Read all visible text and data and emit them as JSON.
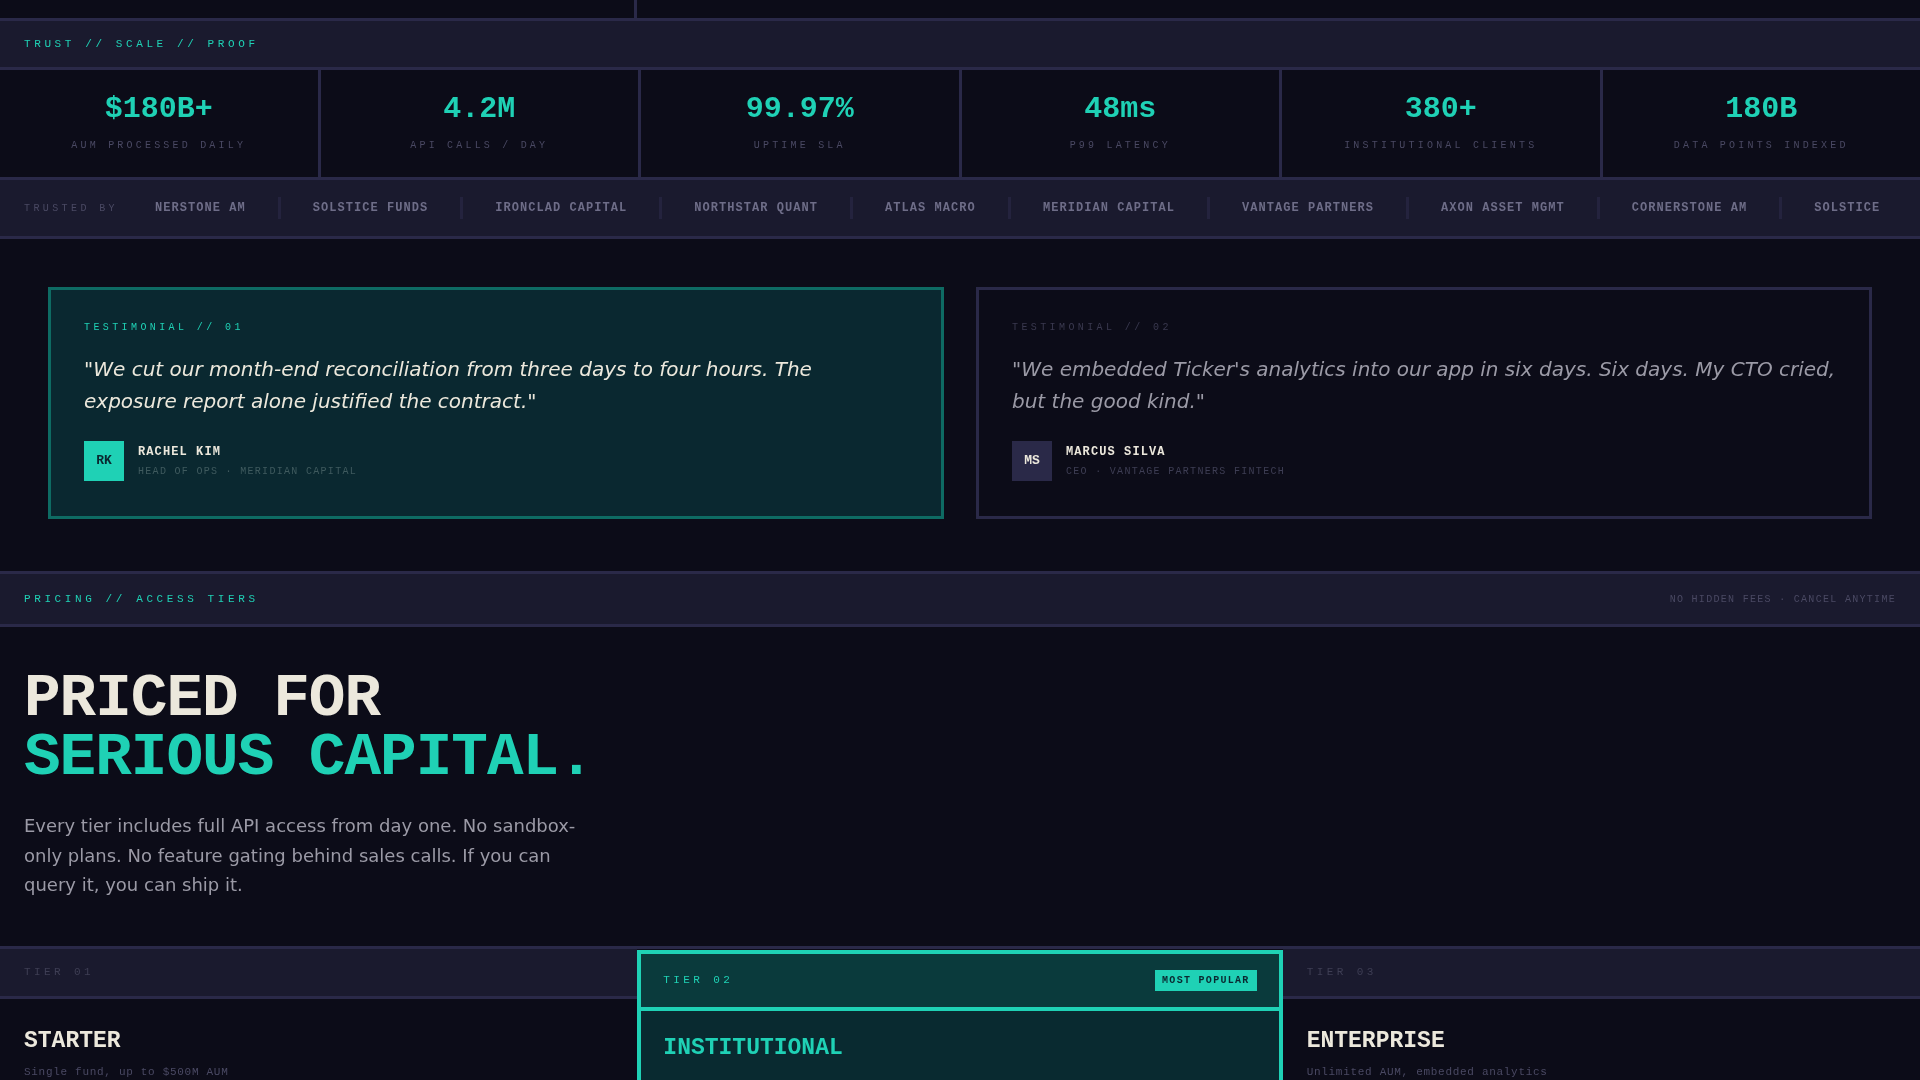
{
  "trust": {
    "label": "TRUST // SCALE // PROOF"
  },
  "stats": [
    {
      "value": "$180B+",
      "label": "AUM PROCESSED DAILY"
    },
    {
      "value": "4.2M",
      "label": "API CALLS / DAY"
    },
    {
      "value": "99.97%",
      "label": "UPTIME SLA"
    },
    {
      "value": "48ms",
      "label": "P99 LATENCY"
    },
    {
      "value": "380+",
      "label": "INSTITUTIONAL CLIENTS"
    },
    {
      "value": "180B",
      "label": "DATA POINTS INDEXED"
    }
  ],
  "trusted_by": {
    "label": "TRUSTED BY",
    "logos": [
      "NERSTONE AM",
      "SOLSTICE FUNDS",
      "IRONCLAD CAPITAL",
      "NORTHSTAR QUANT",
      "ATLAS MACRO",
      "MERIDIAN CAPITAL",
      "VANTAGE PARTNERS",
      "AXON ASSET MGMT",
      "CORNERSTONE AM",
      "SOLSTICE"
    ]
  },
  "testimonials": [
    {
      "label": "TESTIMONIAL // 01",
      "quote": "\"We cut our month-end reconciliation from three days to four hours. The exposure report alone justified the contract.\"",
      "initials": "RK",
      "name": "RACHEL KIM",
      "role": "HEAD OF OPS · MERIDIAN CAPITAL",
      "featured": true
    },
    {
      "label": "TESTIMONIAL // 02",
      "quote": "\"We embedded Ticker's analytics into our app in six days. Six days. My CTO cried, but the good kind.\"",
      "initials": "MS",
      "name": "MARCUS SILVA",
      "role": "CEO · VANTAGE PARTNERS FINTECH",
      "featured": false
    }
  ],
  "pricing": {
    "label": "PRICING // ACCESS TIERS",
    "note": "NO HIDDEN FEES · CANCEL ANYTIME",
    "heading_line_1": "PRICED FOR",
    "heading_line_2": "SERIOUS CAPITAL.",
    "description": "Every tier includes full API access from day one. No sandbox-only plans. No feature gating behind sales calls. If you can query it, you can ship it.",
    "tiers": [
      {
        "label": "TIER 01",
        "name": "STARTER",
        "subtitle": "Single fund, up to $500M AUM",
        "featured": false
      },
      {
        "label": "TIER 02",
        "name": "INSTITUTIONAL",
        "badge": "MOST POPULAR",
        "featured": true
      },
      {
        "label": "TIER 03",
        "name": "ENTERPRISE",
        "subtitle": "Unlimited AUM, embedded analytics",
        "featured": false
      }
    ]
  }
}
